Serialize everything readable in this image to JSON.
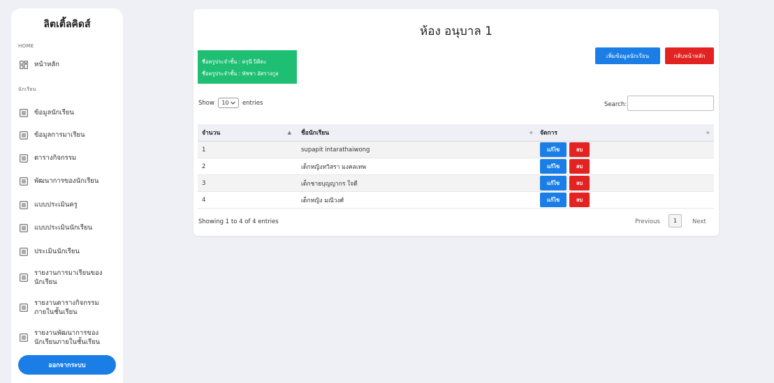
{
  "sidebar": {
    "brand": "ลิตเติ้ลคิดส์",
    "home_section": "HOME",
    "home_item": {
      "label": "หน้าหลัก",
      "icon": "dashboard-icon"
    },
    "student_section": "นักเรียน",
    "items": [
      {
        "label": "ข้อมูลนักเรียน",
        "icon": "list-icon"
      },
      {
        "label": "ข้อมูลการมาเรียน",
        "icon": "list-icon"
      },
      {
        "label": "ตารางกิจกรรม",
        "icon": "list-icon"
      },
      {
        "label": "พัฒนาการของนักเรียน",
        "icon": "list-icon"
      },
      {
        "label": "แบบประเมินครู",
        "icon": "list-icon"
      },
      {
        "label": "แบบประเมินนักเรียน",
        "icon": "list-icon"
      },
      {
        "label": "ประเมินนักเรียน",
        "icon": "list-icon"
      },
      {
        "label": "รายงานการมาเรียนของนักเรียน",
        "icon": "list-icon"
      },
      {
        "label": "รายงานตารางกิจกรรมภายในชั้นเรียน",
        "icon": "list-icon"
      },
      {
        "label": "รายงานพัฒนาการของนักเรียนภายในชั้นเรียน",
        "icon": "list-icon"
      }
    ],
    "logout_label": "ออกจากระบบ"
  },
  "main": {
    "title": "ห้อง อนุบาล 1",
    "teacher_line_1": "ชื่อครูประจำชั้น :   ดรุนี ปิติดะ",
    "teacher_line_2": "ชื่อครูประจำชั้น :   พัชชา อัศรางกูล",
    "add_button": "เพิ่มข้อมูลนักเรียน",
    "back_button": "กลับหน้าหลัก",
    "show_label": "Show",
    "entries_value": "10",
    "entries_label": "entries",
    "search_label": "Search:",
    "search_value": "",
    "columns": [
      "จำนวน",
      "ชื่อนักเรียน",
      "จัดการ"
    ],
    "rows": [
      {
        "no": "1",
        "name": "supapit intarathaiwong"
      },
      {
        "no": "2",
        "name": "เด็กหญิงทวิสรา มงคลเทพ"
      },
      {
        "no": "3",
        "name": "เด็กชายบุญญากร ใจดี"
      },
      {
        "no": "4",
        "name": "เด็กหญิง มณีวงศ์"
      }
    ],
    "edit_label": "แก้ไข",
    "delete_label": "ลบ",
    "info": "Showing 1 to 4 of 4 entries",
    "prev": "Previous",
    "page": "1",
    "next": "Next"
  },
  "colors": {
    "primary": "#1a7ee6",
    "danger": "#e32222",
    "success": "#1fbf73",
    "background": "#eef0f5"
  }
}
